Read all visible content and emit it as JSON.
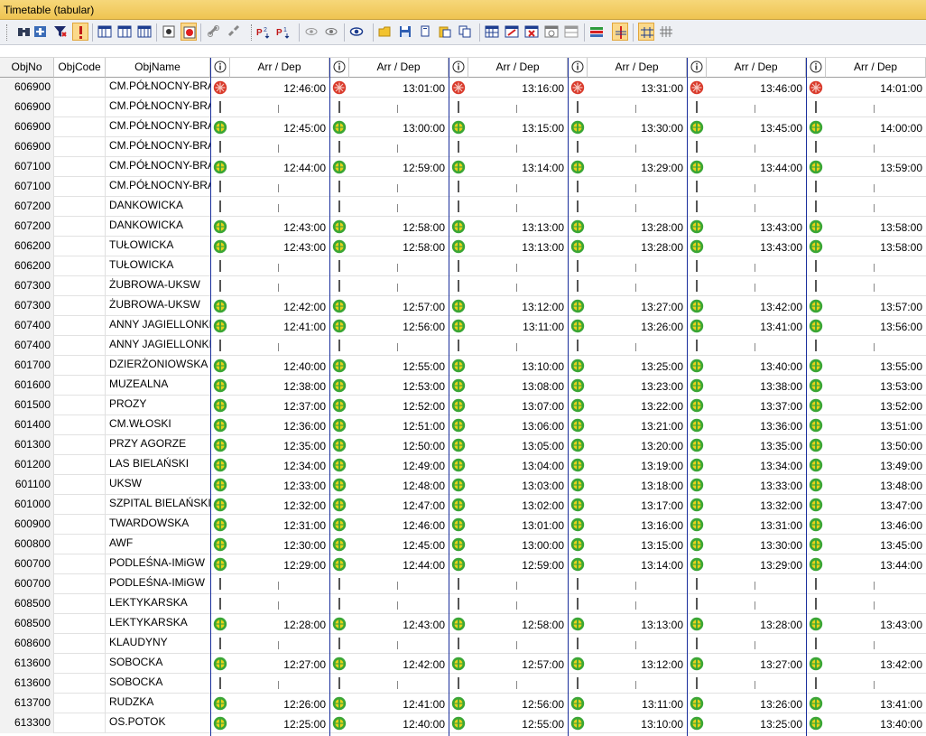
{
  "window": {
    "title": "Timetable (tabular)"
  },
  "toolbar": {
    "buttons": [
      {
        "icon": "binoculars-icon"
      },
      {
        "icon": "add-record-icon"
      },
      {
        "icon": "filter-icon"
      },
      {
        "icon": "priority-filter-icon",
        "checked": true
      },
      {
        "icon": "columns-icon"
      },
      {
        "icon": "columns-alt-icon"
      },
      {
        "icon": "columns-split-icon"
      },
      {
        "icon": "record-dot-icon"
      },
      {
        "icon": "record-red-icon",
        "checked": true
      },
      {
        "icon": "link-icon"
      },
      {
        "icon": "unlink-icon"
      },
      {
        "icon": "sort-asc-icon"
      },
      {
        "icon": "sort-desc-icon"
      },
      {
        "icon": "view-hidden-icon"
      },
      {
        "icon": "view-icon"
      },
      {
        "icon": "eye-focus-icon"
      },
      {
        "icon": "open-folder-icon"
      },
      {
        "icon": "save-icon"
      },
      {
        "icon": "copy-icon"
      },
      {
        "icon": "paste-icon"
      },
      {
        "icon": "paste-alt-icon"
      },
      {
        "icon": "grid-insert-icon"
      },
      {
        "icon": "grid-edit-icon"
      },
      {
        "icon": "grid-delete-icon"
      },
      {
        "icon": "grid-info-icon"
      },
      {
        "icon": "grid-disabled-icon"
      },
      {
        "icon": "color-bars-icon"
      },
      {
        "icon": "crossing-icon",
        "checked": true
      },
      {
        "icon": "hash-icon",
        "checked": true
      },
      {
        "icon": "hash-grid-icon"
      }
    ]
  },
  "table": {
    "headers": {
      "objno": "ObjNo",
      "objcode": "ObjCode",
      "objname": "ObjName",
      "info": "ⓘ",
      "arrdep": "Arr / Dep"
    },
    "colors": {
      "grid_line": "#1a2f9c",
      "stop_green": "#3aa635",
      "stop_yellow": "#e8d21a",
      "start_red": "#d93a2b"
    },
    "trip_count": 6,
    "rows": [
      {
        "no": "606900",
        "name": "CM.PÓŁNOCNY-BRAMA",
        "kind": "start",
        "times": [
          "12:46:00",
          "13:01:00",
          "13:16:00",
          "13:31:00",
          "13:46:00",
          "14:01:00"
        ]
      },
      {
        "no": "606900",
        "name": "CM.PÓŁNOCNY-BRAMA",
        "kind": "pass",
        "times": []
      },
      {
        "no": "606900",
        "name": "CM.PÓŁNOCNY-BRAMA",
        "kind": "stop",
        "times": [
          "12:45:00",
          "13:00:00",
          "13:15:00",
          "13:30:00",
          "13:45:00",
          "14:00:00"
        ]
      },
      {
        "no": "606900",
        "name": "CM.PÓŁNOCNY-BRAMA",
        "kind": "pass",
        "times": []
      },
      {
        "no": "607100",
        "name": "CM.PÓŁNOCNY-BRAMA",
        "kind": "stop",
        "times": [
          "12:44:00",
          "12:59:00",
          "13:14:00",
          "13:29:00",
          "13:44:00",
          "13:59:00"
        ]
      },
      {
        "no": "607100",
        "name": "CM.PÓŁNOCNY-BRAMA",
        "kind": "pass",
        "times": []
      },
      {
        "no": "607200",
        "name": "DANKOWICKA",
        "kind": "pass",
        "times": []
      },
      {
        "no": "607200",
        "name": "DANKOWICKA",
        "kind": "stop",
        "times": [
          "12:43:00",
          "12:58:00",
          "13:13:00",
          "13:28:00",
          "13:43:00",
          "13:58:00"
        ]
      },
      {
        "no": "606200",
        "name": "TUŁOWICKA",
        "kind": "stop",
        "times": [
          "12:43:00",
          "12:58:00",
          "13:13:00",
          "13:28:00",
          "13:43:00",
          "13:58:00"
        ]
      },
      {
        "no": "606200",
        "name": "TUŁOWICKA",
        "kind": "pass",
        "times": []
      },
      {
        "no": "607300",
        "name": "ŻUBROWA-UKSW",
        "kind": "pass",
        "times": []
      },
      {
        "no": "607300",
        "name": "ŻUBROWA-UKSW",
        "kind": "stop",
        "times": [
          "12:42:00",
          "12:57:00",
          "13:12:00",
          "13:27:00",
          "13:42:00",
          "13:57:00"
        ]
      },
      {
        "no": "607400",
        "name": "ANNY JAGIELLONKI",
        "kind": "stop",
        "times": [
          "12:41:00",
          "12:56:00",
          "13:11:00",
          "13:26:00",
          "13:41:00",
          "13:56:00"
        ]
      },
      {
        "no": "607400",
        "name": "ANNY JAGIELLONKI",
        "kind": "pass",
        "times": []
      },
      {
        "no": "601700",
        "name": "DZIERŻONIOWSKA",
        "kind": "stop",
        "times": [
          "12:40:00",
          "12:55:00",
          "13:10:00",
          "13:25:00",
          "13:40:00",
          "13:55:00"
        ]
      },
      {
        "no": "601600",
        "name": "MUZEALNA",
        "kind": "stop",
        "times": [
          "12:38:00",
          "12:53:00",
          "13:08:00",
          "13:23:00",
          "13:38:00",
          "13:53:00"
        ]
      },
      {
        "no": "601500",
        "name": "PROZY",
        "kind": "stop",
        "times": [
          "12:37:00",
          "12:52:00",
          "13:07:00",
          "13:22:00",
          "13:37:00",
          "13:52:00"
        ]
      },
      {
        "no": "601400",
        "name": "CM.WŁOSKI",
        "kind": "stop",
        "times": [
          "12:36:00",
          "12:51:00",
          "13:06:00",
          "13:21:00",
          "13:36:00",
          "13:51:00"
        ]
      },
      {
        "no": "601300",
        "name": "PRZY AGORZE",
        "kind": "stop",
        "times": [
          "12:35:00",
          "12:50:00",
          "13:05:00",
          "13:20:00",
          "13:35:00",
          "13:50:00"
        ]
      },
      {
        "no": "601200",
        "name": "LAS BIELAŃSKI",
        "kind": "stop",
        "times": [
          "12:34:00",
          "12:49:00",
          "13:04:00",
          "13:19:00",
          "13:34:00",
          "13:49:00"
        ]
      },
      {
        "no": "601100",
        "name": "UKSW",
        "kind": "stop",
        "times": [
          "12:33:00",
          "12:48:00",
          "13:03:00",
          "13:18:00",
          "13:33:00",
          "13:48:00"
        ]
      },
      {
        "no": "601000",
        "name": "SZPITAL BIELAŃSKI",
        "kind": "stop",
        "times": [
          "12:32:00",
          "12:47:00",
          "13:02:00",
          "13:17:00",
          "13:32:00",
          "13:47:00"
        ]
      },
      {
        "no": "600900",
        "name": "TWARDOWSKA",
        "kind": "stop",
        "times": [
          "12:31:00",
          "12:46:00",
          "13:01:00",
          "13:16:00",
          "13:31:00",
          "13:46:00"
        ]
      },
      {
        "no": "600800",
        "name": "AWF",
        "kind": "stop",
        "times": [
          "12:30:00",
          "12:45:00",
          "13:00:00",
          "13:15:00",
          "13:30:00",
          "13:45:00"
        ]
      },
      {
        "no": "600700",
        "name": "PODLEŚNA-IMiGW",
        "kind": "stop",
        "times": [
          "12:29:00",
          "12:44:00",
          "12:59:00",
          "13:14:00",
          "13:29:00",
          "13:44:00"
        ]
      },
      {
        "no": "600700",
        "name": "PODLEŚNA-IMiGW",
        "kind": "pass",
        "times": []
      },
      {
        "no": "608500",
        "name": "LEKTYKARSKA",
        "kind": "pass",
        "times": []
      },
      {
        "no": "608500",
        "name": "LEKTYKARSKA",
        "kind": "stop",
        "times": [
          "12:28:00",
          "12:43:00",
          "12:58:00",
          "13:13:00",
          "13:28:00",
          "13:43:00"
        ]
      },
      {
        "no": "608600",
        "name": "KLAUDYNY",
        "kind": "pass",
        "times": []
      },
      {
        "no": "613600",
        "name": "SOBOCKA",
        "kind": "stop",
        "times": [
          "12:27:00",
          "12:42:00",
          "12:57:00",
          "13:12:00",
          "13:27:00",
          "13:42:00"
        ]
      },
      {
        "no": "613600",
        "name": "SOBOCKA",
        "kind": "pass",
        "times": []
      },
      {
        "no": "613700",
        "name": "RUDZKA",
        "kind": "stop",
        "times": [
          "12:26:00",
          "12:41:00",
          "12:56:00",
          "13:11:00",
          "13:26:00",
          "13:41:00"
        ]
      },
      {
        "no": "613300",
        "name": "OS.POTOK",
        "kind": "stop",
        "times": [
          "12:25:00",
          "12:40:00",
          "12:55:00",
          "13:10:00",
          "13:25:00",
          "13:40:00"
        ]
      }
    ]
  }
}
